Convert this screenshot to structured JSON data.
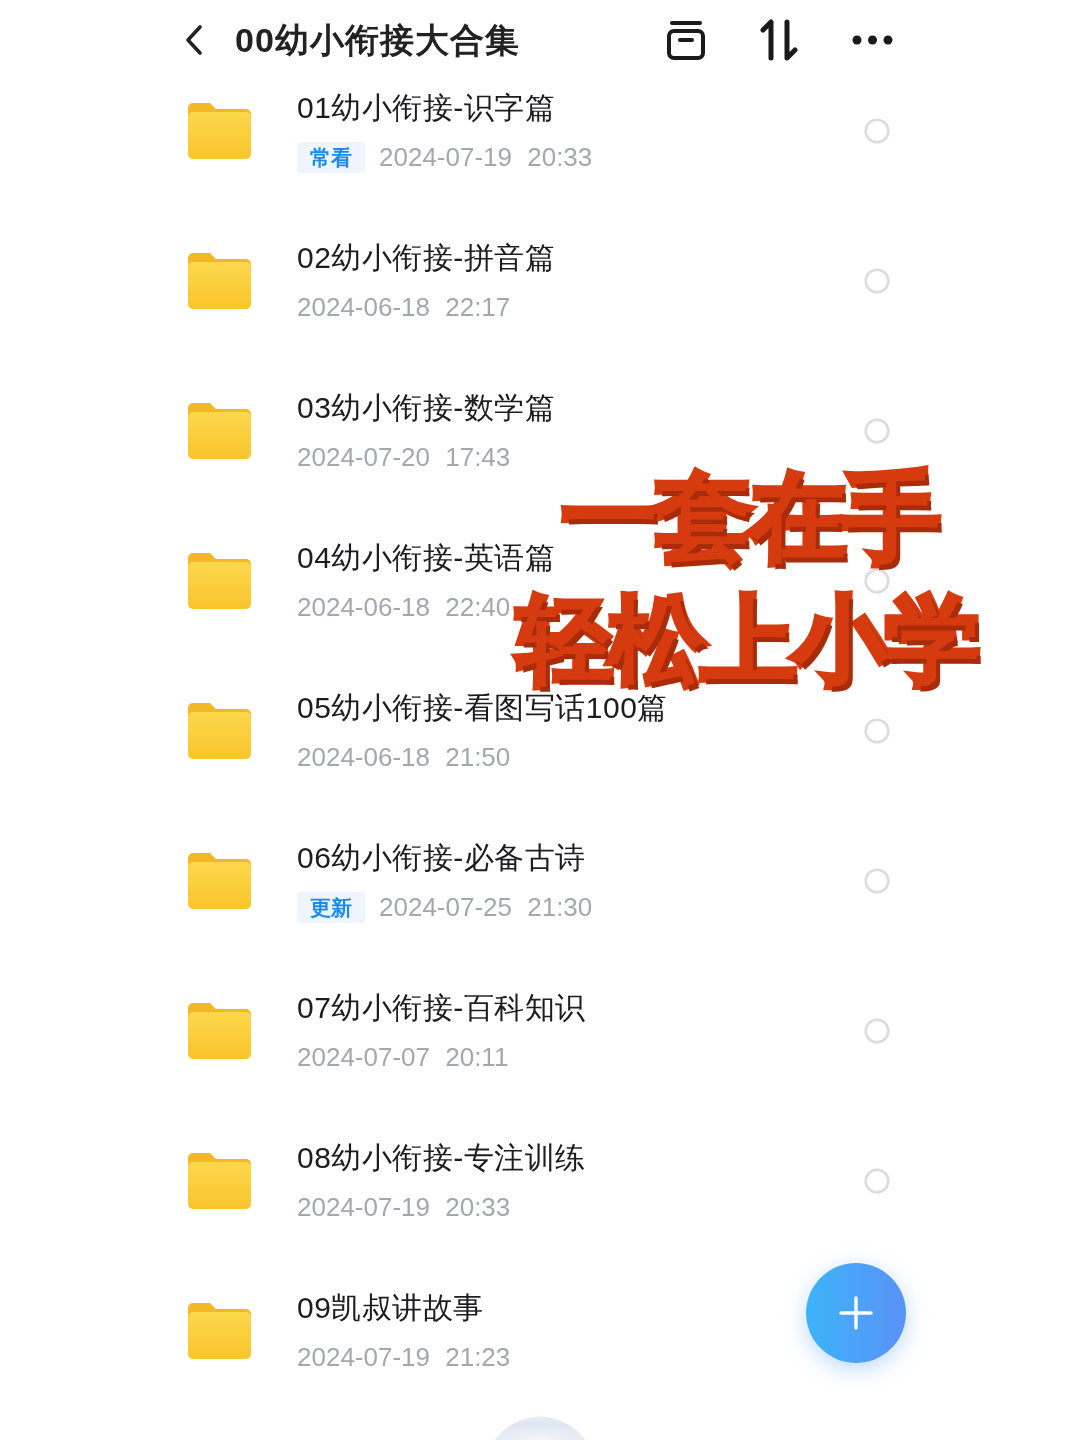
{
  "header": {
    "title": "00幼小衔接大合集"
  },
  "folders": [
    {
      "name": "01幼小衔接-识字篇",
      "tag": "常看",
      "modified": "2024-07-19 20:33",
      "selected": false
    },
    {
      "name": "02幼小衔接-拼音篇",
      "modified": "2024-06-18 22:17",
      "selected": false
    },
    {
      "name": "03幼小衔接-数学篇",
      "modified": "2024-07-20 17:43",
      "selected": false
    },
    {
      "name": "04幼小衔接-英语篇",
      "modified": "2024-06-18 22:40",
      "selected": false
    },
    {
      "name": "05幼小衔接-看图写话100篇",
      "modified": "2024-06-18 21:50",
      "selected": false
    },
    {
      "name": "06幼小衔接-必备古诗",
      "tag": "更新",
      "modified": "2024-07-25 21:30",
      "selected": false
    },
    {
      "name": "07幼小衔接-百科知识",
      "modified": "2024-07-07 20:11",
      "selected": false
    },
    {
      "name": "08幼小衔接-专注训练",
      "modified": "2024-07-19 20:33",
      "selected": false
    },
    {
      "name": "09凯叔讲故事",
      "modified": "2024-07-19 21:23"
    }
  ],
  "overlay": {
    "lines": [
      "一套在手",
      "轻松上小学"
    ]
  }
}
